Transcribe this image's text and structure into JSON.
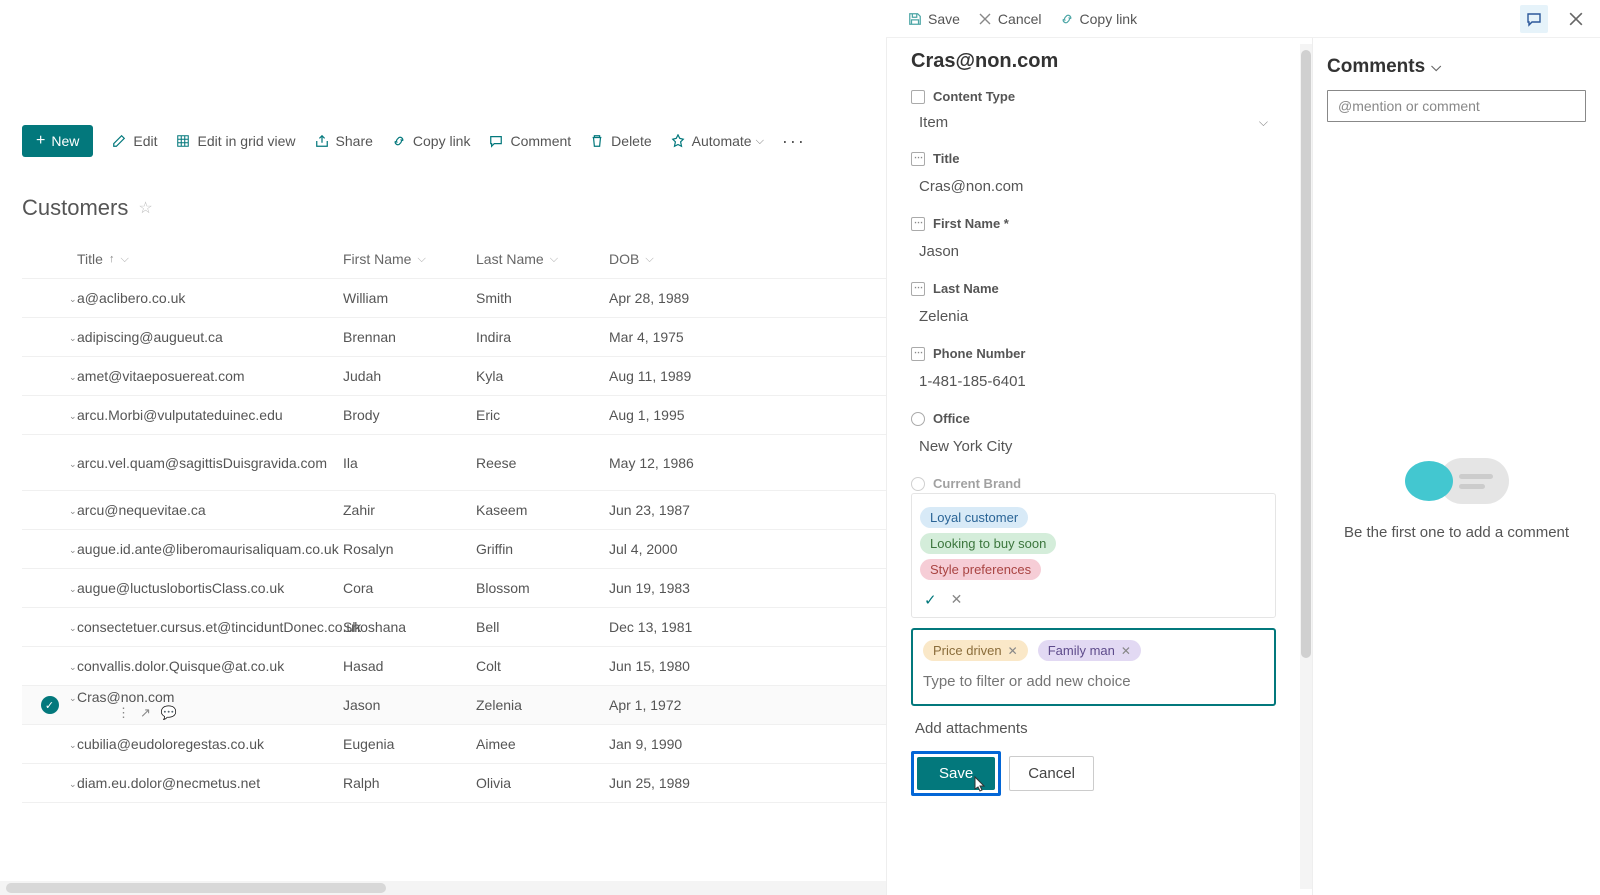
{
  "panelTop": {
    "save": "Save",
    "cancel": "Cancel",
    "copyLink": "Copy link"
  },
  "listToolbar": {
    "new": "New",
    "edit": "Edit",
    "editGrid": "Edit in grid view",
    "share": "Share",
    "copyLink": "Copy link",
    "comment": "Comment",
    "delete": "Delete",
    "automate": "Automate"
  },
  "listTitle": "Customers",
  "columns": {
    "title": "Title",
    "first": "First Name",
    "last": "Last Name",
    "dob": "DOB"
  },
  "rows": [
    {
      "title": "a@aclibero.co.uk",
      "first": "William",
      "last": "Smith",
      "dob": "Apr 28, 1989"
    },
    {
      "title": "adipiscing@augueut.ca",
      "first": "Brennan",
      "last": "Indira",
      "dob": "Mar 4, 1975"
    },
    {
      "title": "amet@vitaeposuereat.com",
      "first": "Judah",
      "last": "Kyla",
      "dob": "Aug 11, 1989"
    },
    {
      "title": "arcu.Morbi@vulputateduinec.edu",
      "first": "Brody",
      "last": "Eric",
      "dob": "Aug 1, 1995"
    },
    {
      "title": "arcu.vel.quam@sagittisDuisgravida.com",
      "first": "Ila",
      "last": "Reese",
      "dob": "May 12, 1986"
    },
    {
      "title": "arcu@nequevitae.ca",
      "first": "Zahir",
      "last": "Kaseem",
      "dob": "Jun 23, 1987"
    },
    {
      "title": "augue.id.ante@liberomaurisaliquam.co.uk",
      "first": "Rosalyn",
      "last": "Griffin",
      "dob": "Jul 4, 2000"
    },
    {
      "title": "augue@luctuslobortisClass.co.uk",
      "first": "Cora",
      "last": "Blossom",
      "dob": "Jun 19, 1983"
    },
    {
      "title": "consectetuer.cursus.et@tinciduntDonec.co.uk",
      "first": "Shoshana",
      "last": "Bell",
      "dob": "Dec 13, 1981"
    },
    {
      "title": "convallis.dolor.Quisque@at.co.uk",
      "first": "Hasad",
      "last": "Colt",
      "dob": "Jun 15, 1980"
    },
    {
      "title": "Cras@non.com",
      "first": "Jason",
      "last": "Zelenia",
      "dob": "Apr 1, 1972",
      "selected": true
    },
    {
      "title": "cubilia@eudoloregestas.co.uk",
      "first": "Eugenia",
      "last": "Aimee",
      "dob": "Jan 9, 1990"
    },
    {
      "title": "diam.eu.dolor@necmetus.net",
      "first": "Ralph",
      "last": "Olivia",
      "dob": "Jun 25, 1989"
    }
  ],
  "form": {
    "heading": "Cras@non.com",
    "labels": {
      "contentType": "Content Type",
      "title": "Title",
      "firstName": "First Name *",
      "lastName": "Last Name",
      "phone": "Phone Number",
      "office": "Office",
      "currentBrand": "Current Brand"
    },
    "values": {
      "contentType": "Item",
      "title": "Cras@non.com",
      "firstName": "Jason",
      "lastName": "Zelenia",
      "phone": "1-481-185-6401",
      "office": "New York City"
    },
    "choices": {
      "option1": "Loyal customer",
      "option2": "Looking to buy soon",
      "option3": "Style preferences"
    },
    "selectedTags": {
      "tag1": "Price driven",
      "tag2": "Family man"
    },
    "filterPlaceholder": "Type to filter or add new choice",
    "addAttachments": "Add attachments",
    "saveBtn": "Save",
    "cancelBtn": "Cancel"
  },
  "comments": {
    "title": "Comments",
    "placeholder": "@mention or comment",
    "emptyText": "Be the first one to add a comment"
  }
}
